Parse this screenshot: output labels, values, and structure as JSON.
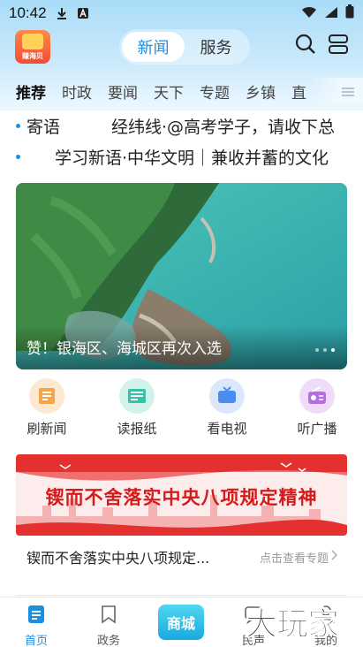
{
  "status_bar": {
    "time": "10:42"
  },
  "header": {
    "logo_text": "赚海贝",
    "tabs": [
      {
        "label": "新闻",
        "active": true
      },
      {
        "label": "服务",
        "active": false
      }
    ]
  },
  "channels": [
    "推荐",
    "时政",
    "要闻",
    "天下",
    "专题",
    "乡镇",
    "直"
  ],
  "ticker": [
    {
      "text": "寄语",
      "text2": "经纬线·@高考学子，请收下总"
    },
    {
      "text": "学习新语·中华文明｜兼收并蓄的文化"
    }
  ],
  "banner": {
    "caption": "赞！银海区、海城区再次入选"
  },
  "quick_links": [
    {
      "label": "刷新闻",
      "icon": "news-icon",
      "color": "#f5a54a"
    },
    {
      "label": "读报纸",
      "icon": "newspaper-icon",
      "color": "#34c3a6"
    },
    {
      "label": "看电视",
      "icon": "tv-icon",
      "color": "#4a8cf0"
    },
    {
      "label": "听广播",
      "icon": "radio-icon",
      "color": "#b36ee0"
    }
  ],
  "promo": {
    "headline": "锲而不舍落实中央八项规定精神",
    "title": "锲而不舍落实中央八项规定...",
    "link": "点击查看专题"
  },
  "tabbar": [
    {
      "label": "首页",
      "active": true
    },
    {
      "label": "政务",
      "active": false
    },
    {
      "label": "商城",
      "active": false
    },
    {
      "label": "民声",
      "active": false
    },
    {
      "label": "我的",
      "active": false
    }
  ],
  "watermark": "大玩家",
  "colors": {
    "accent": "#1d8fe0",
    "promo_red": "#d41a1a"
  }
}
